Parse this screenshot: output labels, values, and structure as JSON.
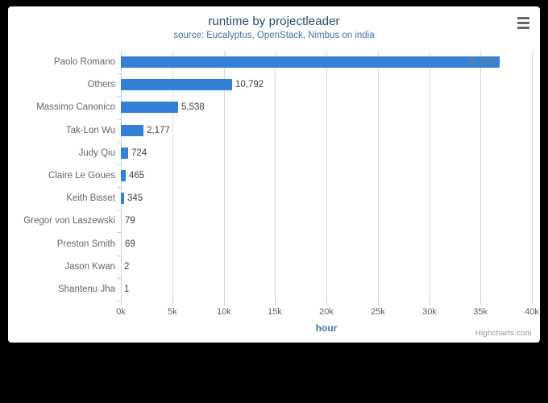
{
  "chart_data": {
    "type": "bar",
    "title": "runtime by projectleader",
    "subtitle": "source: Eucalyptus, OpenStack, Nimbus on india",
    "xlabel": "hour",
    "ylabel": "",
    "orientation": "horizontal",
    "grid": true,
    "legend": false,
    "xlim": [
      0,
      40000
    ],
    "xticks": [
      0,
      5000,
      10000,
      15000,
      20000,
      25000,
      30000,
      35000,
      40000
    ],
    "xticklabels": [
      "0k",
      "5k",
      "10k",
      "15k",
      "20k",
      "25k",
      "30k",
      "35k",
      "40k"
    ],
    "categories": [
      "Paolo Romano",
      "Others",
      "Massimo Canonico",
      "Tak-Lon Wu",
      "Judy Qiu",
      "Claire Le Goues",
      "Keith Bisset",
      "Gregor von Laszewski",
      "Preston Smith",
      "Jason Kwan",
      "Shantenu Jha"
    ],
    "values": [
      36830,
      10792,
      5538,
      2177,
      724,
      465,
      345,
      79,
      69,
      2,
      1
    ],
    "value_labels": [
      "36,830",
      "10,792",
      "5,538",
      "2,177",
      "724",
      "465",
      "345",
      "79",
      "69",
      "2",
      "1"
    ],
    "series_color": "#3380d8"
  },
  "colors": {
    "bar": "#3380d8",
    "title": "#274b6d",
    "subtitle": "#4572a7",
    "axis_title": "#4572a7",
    "tick_label": "#606060",
    "category_label": "#666666",
    "data_label": "#444444",
    "data_label_inside": "#717c8a",
    "gridline": "#d8d8d8",
    "card_background": "#ffffff",
    "page_background": "#000000"
  },
  "toolbar": {
    "context_menu_label": "Chart context menu"
  },
  "credits": {
    "text": "Highcharts.com"
  }
}
